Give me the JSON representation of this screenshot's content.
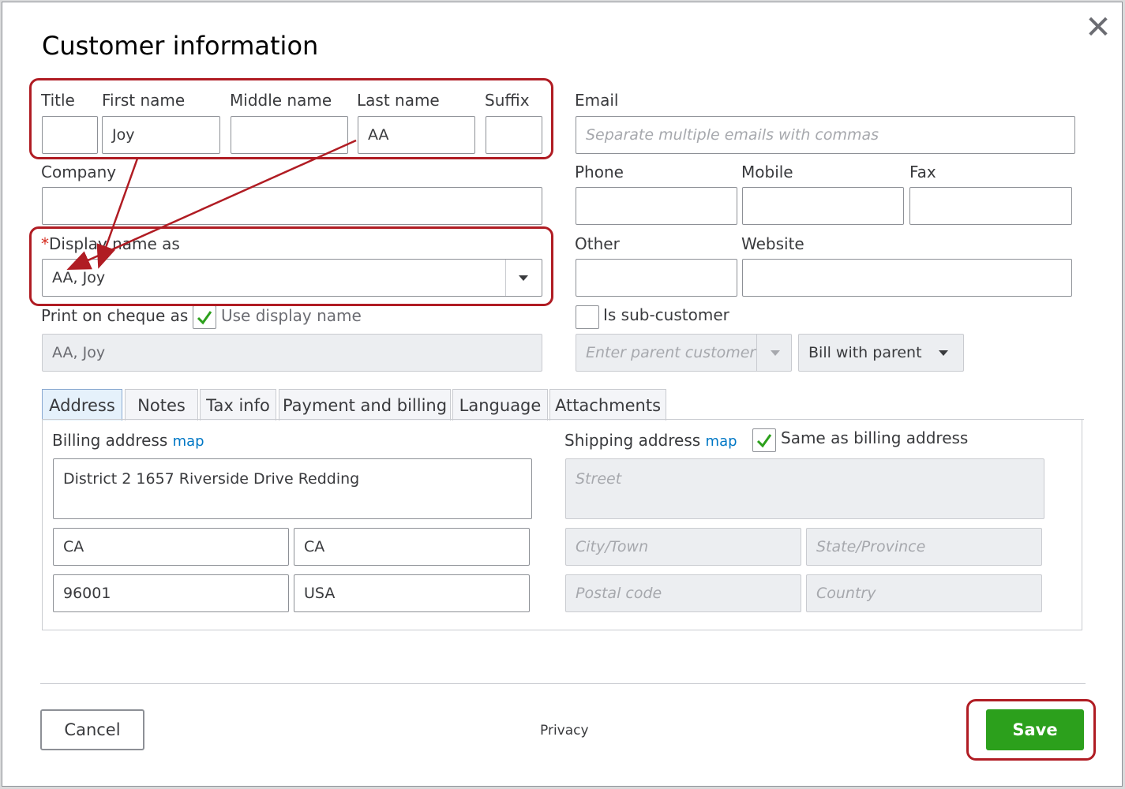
{
  "dialog": {
    "title": "Customer information",
    "close_glyph": "✕"
  },
  "name": {
    "title_label": "Title",
    "first_label": "First name",
    "first_value": "Joy",
    "middle_label": "Middle name",
    "last_label": "Last name",
    "last_value": "AA",
    "suffix_label": "Suffix"
  },
  "company": {
    "label": "Company"
  },
  "display_name": {
    "required_mark": "*",
    "label": "Display name as",
    "value": "AA, Joy"
  },
  "print_on_cheque": {
    "label": "Print on cheque as",
    "use_display_label": "Use display name",
    "value": "AA, Joy"
  },
  "contact": {
    "email_label": "Email",
    "email_placeholder": "Separate multiple emails with commas",
    "phone_label": "Phone",
    "mobile_label": "Mobile",
    "fax_label": "Fax",
    "other_label": "Other",
    "website_label": "Website"
  },
  "sub_customer": {
    "label": "Is sub-customer",
    "parent_placeholder": "Enter parent customer",
    "bill_with": "Bill with parent"
  },
  "tabs": [
    {
      "label": "Address"
    },
    {
      "label": "Notes"
    },
    {
      "label": "Tax info"
    },
    {
      "label": "Payment and billing"
    },
    {
      "label": "Language"
    },
    {
      "label": "Attachments"
    }
  ],
  "billing": {
    "label": "Billing address",
    "map": "map",
    "street": "District 2 1657 Riverside Drive Redding",
    "city": "CA",
    "state": "CA",
    "postal": "96001",
    "country": "USA"
  },
  "shipping": {
    "label": "Shipping address",
    "map": "map",
    "same_label": "Same as billing address",
    "street_ph": "Street",
    "city_ph": "City/Town",
    "state_ph": "State/Province",
    "postal_ph": "Postal code",
    "country_ph": "Country"
  },
  "footer": {
    "cancel": "Cancel",
    "privacy": "Privacy",
    "save": "Save"
  },
  "colors": {
    "highlight": "#b01c23",
    "save": "#2ca01c",
    "link": "#0077c5"
  }
}
